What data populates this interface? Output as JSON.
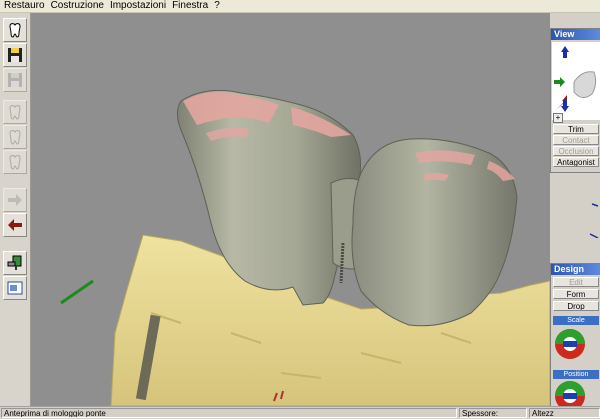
{
  "menu": [
    "Restauro",
    "Costruzione",
    "Impostazioni",
    "Finestra",
    "?"
  ],
  "toolbar": {
    "buttons": [
      {
        "name": "tooth-icon",
        "disabled": false
      },
      {
        "name": "save-icon",
        "disabled": false
      },
      {
        "name": "save-disabled-icon",
        "disabled": true
      },
      {
        "name": "tooth-outline-1-icon",
        "disabled": true
      },
      {
        "name": "tooth-outline-2-icon",
        "disabled": true
      },
      {
        "name": "tooth-outline-3-icon",
        "disabled": true
      },
      {
        "name": "forward-arrow-icon",
        "disabled": true
      },
      {
        "name": "back-arrow-icon",
        "disabled": false
      },
      {
        "name": "tool-icon",
        "disabled": false
      },
      {
        "name": "export-icon",
        "disabled": false
      }
    ]
  },
  "view_panel": {
    "title": "View",
    "buttons": [
      {
        "label": "Trim",
        "disabled": false
      },
      {
        "label": "Contact",
        "disabled": true
      },
      {
        "label": "Occlusion",
        "disabled": true
      },
      {
        "label": "Antagonist",
        "disabled": false
      }
    ]
  },
  "design_panel": {
    "title": "Design",
    "buttons": [
      {
        "label": "Edit",
        "disabled": true
      },
      {
        "label": "Form",
        "disabled": false
      },
      {
        "label": "Drop",
        "disabled": false
      }
    ],
    "scale_label": "Scale",
    "position_label": "Position"
  },
  "status": {
    "message": "Anteprima di mologgio ponte",
    "spessore_label": "Spessore:",
    "altezza_label": "Altezz"
  },
  "colors": {
    "tooth": "#a8ab98",
    "gum_model": "#e8d88c",
    "margin_pink": "#e4a4a0",
    "background": "#8f8f8f"
  }
}
